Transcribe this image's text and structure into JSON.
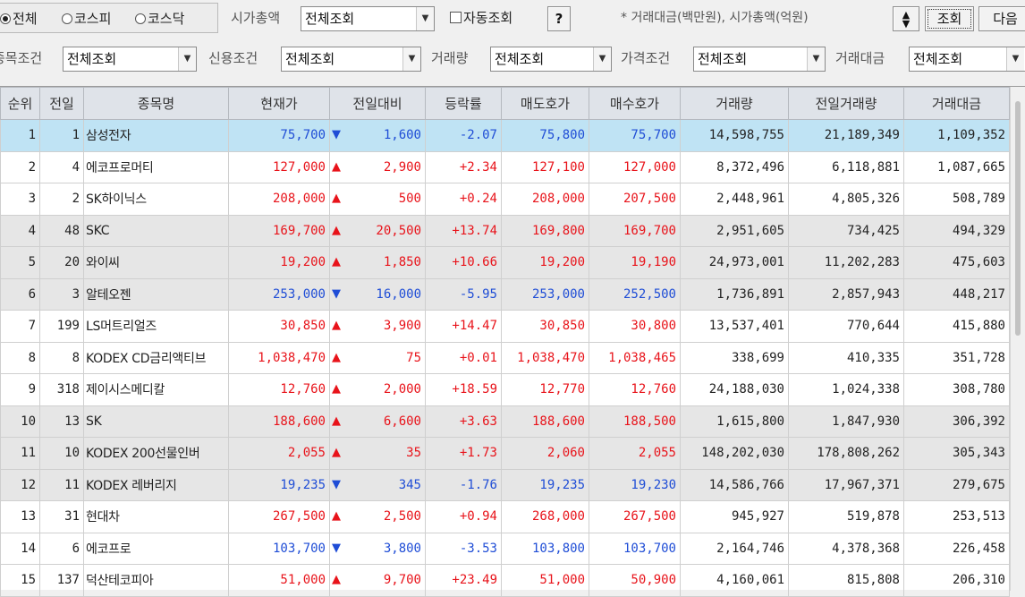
{
  "filter_bar": {
    "market_options": [
      {
        "label": "전체",
        "checked": true
      },
      {
        "label": "코스피",
        "checked": false
      },
      {
        "label": "코스닥",
        "checked": false
      }
    ],
    "marketcap_label": "시가총액",
    "marketcap_value": "전체조회",
    "auto_query_label": "자동조회",
    "auto_query_checked": false,
    "help_label": "?",
    "unit_note": "* 거래대금(백만원), 시가총액(억원)",
    "query_label": "조회",
    "next_label": "다음",
    "stock_cond_label": "종목조건",
    "stock_cond_value": "전체조회",
    "credit_label": "신용조건",
    "credit_value": "전체조회",
    "volume_label": "거래량",
    "volume_value": "전체조회",
    "price_label": "가격조건",
    "price_value": "전체조회",
    "amount_label": "거래대금",
    "amount_value": "전체조회"
  },
  "table": {
    "columns": [
      "순위",
      "전일",
      "종목명",
      "현재가",
      "전일대비",
      "등락률",
      "매도호가",
      "매수호가",
      "거래량",
      "전일거래량",
      "거래대금"
    ],
    "colors": {
      "up": "#e8131a",
      "down": "#1f4dd6"
    },
    "rows": [
      {
        "rank": "1",
        "prev": "1",
        "name": "삼성전자",
        "price": "75,700",
        "dir": "down",
        "change": "1,600",
        "rate": "-2.07",
        "ask": "75,800",
        "bid": "75,700",
        "volume": "14,598,755",
        "prev_volume": "21,189,349",
        "amount": "1,109,352"
      },
      {
        "rank": "2",
        "prev": "4",
        "name": "에코프로머티",
        "price": "127,000",
        "dir": "up",
        "change": "2,900",
        "rate": "+2.34",
        "ask": "127,100",
        "bid": "127,000",
        "volume": "8,372,496",
        "prev_volume": "6,118,881",
        "amount": "1,087,665"
      },
      {
        "rank": "3",
        "prev": "2",
        "name": "SK하이닉스",
        "price": "208,000",
        "dir": "up",
        "change": "500",
        "rate": "+0.24",
        "ask": "208,000",
        "bid": "207,500",
        "volume": "2,448,961",
        "prev_volume": "4,805,326",
        "amount": "508,789"
      },
      {
        "rank": "4",
        "prev": "48",
        "name": "SKC",
        "price": "169,700",
        "dir": "up",
        "change": "20,500",
        "rate": "+13.74",
        "ask": "169,800",
        "bid": "169,700",
        "volume": "2,951,605",
        "prev_volume": "734,425",
        "amount": "494,329"
      },
      {
        "rank": "5",
        "prev": "20",
        "name": "와이씨",
        "price": "19,200",
        "dir": "up",
        "change": "1,850",
        "rate": "+10.66",
        "ask": "19,200",
        "bid": "19,190",
        "volume": "24,973,001",
        "prev_volume": "11,202,283",
        "amount": "475,603"
      },
      {
        "rank": "6",
        "prev": "3",
        "name": "알테오젠",
        "price": "253,000",
        "dir": "down",
        "change": "16,000",
        "rate": "-5.95",
        "ask": "253,000",
        "bid": "252,500",
        "volume": "1,736,891",
        "prev_volume": "2,857,943",
        "amount": "448,217"
      },
      {
        "rank": "7",
        "prev": "199",
        "name": "LS머트리얼즈",
        "price": "30,850",
        "dir": "up",
        "change": "3,900",
        "rate": "+14.47",
        "ask": "30,850",
        "bid": "30,800",
        "volume": "13,537,401",
        "prev_volume": "770,644",
        "amount": "415,880"
      },
      {
        "rank": "8",
        "prev": "8",
        "name": "KODEX CD금리액티브",
        "price": "1,038,470",
        "dir": "up",
        "change": "75",
        "rate": "+0.01",
        "ask": "1,038,470",
        "bid": "1,038,465",
        "volume": "338,699",
        "prev_volume": "410,335",
        "amount": "351,728"
      },
      {
        "rank": "9",
        "prev": "318",
        "name": "제이시스메디칼",
        "price": "12,760",
        "dir": "up",
        "change": "2,000",
        "rate": "+18.59",
        "ask": "12,770",
        "bid": "12,760",
        "volume": "24,188,030",
        "prev_volume": "1,024,338",
        "amount": "308,780"
      },
      {
        "rank": "10",
        "prev": "13",
        "name": "SK",
        "price": "188,600",
        "dir": "up",
        "change": "6,600",
        "rate": "+3.63",
        "ask": "188,600",
        "bid": "188,500",
        "volume": "1,615,800",
        "prev_volume": "1,847,930",
        "amount": "306,392"
      },
      {
        "rank": "11",
        "prev": "10",
        "name": "KODEX 200선물인버",
        "price": "2,055",
        "dir": "up",
        "change": "35",
        "rate": "+1.73",
        "ask": "2,060",
        "bid": "2,055",
        "volume": "148,202,030",
        "prev_volume": "178,808,262",
        "amount": "305,343"
      },
      {
        "rank": "12",
        "prev": "11",
        "name": "KODEX 레버리지",
        "price": "19,235",
        "dir": "down",
        "change": "345",
        "rate": "-1.76",
        "ask": "19,235",
        "bid": "19,230",
        "volume": "14,586,766",
        "prev_volume": "17,967,371",
        "amount": "279,675"
      },
      {
        "rank": "13",
        "prev": "31",
        "name": "현대차",
        "price": "267,500",
        "dir": "up",
        "change": "2,500",
        "rate": "+0.94",
        "ask": "268,000",
        "bid": "267,500",
        "volume": "945,927",
        "prev_volume": "519,878",
        "amount": "253,513"
      },
      {
        "rank": "14",
        "prev": "6",
        "name": "에코프로",
        "price": "103,700",
        "dir": "down",
        "change": "3,800",
        "rate": "-3.53",
        "ask": "103,800",
        "bid": "103,700",
        "volume": "2,164,746",
        "prev_volume": "4,378,368",
        "amount": "226,458"
      },
      {
        "rank": "15",
        "prev": "137",
        "name": "덕산테코피아",
        "price": "51,000",
        "dir": "up",
        "change": "9,700",
        "rate": "+23.49",
        "ask": "51,000",
        "bid": "50,900",
        "volume": "4,160,061",
        "prev_volume": "815,808",
        "amount": "206,310"
      }
    ]
  }
}
